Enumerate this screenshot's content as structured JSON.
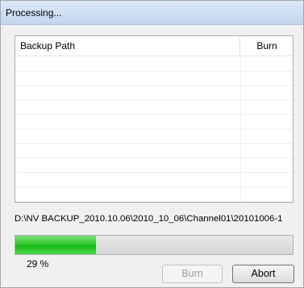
{
  "window": {
    "title": "Processing..."
  },
  "list": {
    "columns": [
      "Backup Path",
      "Burn"
    ],
    "rows": []
  },
  "current_path": "D:\\NV BACKUP_2010.10.06\\2010_10_06\\Channel01\\20101006-1",
  "progress": {
    "value": 29,
    "label": "29 %",
    "fill_color": "#2fc92f"
  },
  "buttons": {
    "burn_label": "Burn",
    "burn_enabled": false,
    "abort_label": "Abort",
    "abort_enabled": true
  }
}
